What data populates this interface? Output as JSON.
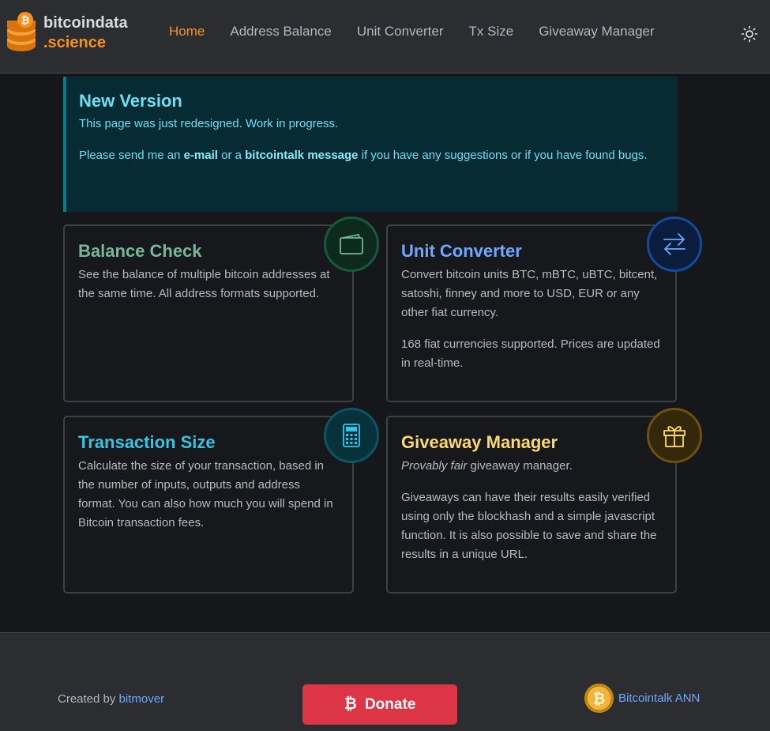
{
  "header": {
    "logo_line1": "bitcoindata",
    "logo_line2": ".science",
    "nav": [
      {
        "label": "Home",
        "active": true
      },
      {
        "label": "Address Balance",
        "active": false
      },
      {
        "label": "Unit Converter",
        "active": false
      },
      {
        "label": "Tx Size",
        "active": false
      },
      {
        "label": "Giveaway Manager",
        "active": false
      }
    ],
    "theme_icon": "sun-icon"
  },
  "alert": {
    "title": "New Version",
    "line1": "This page was just redesigned. Work in progress.",
    "line2_prefix": "Please send me an ",
    "email_link": "e-mail",
    "line2_mid": " or a ",
    "bct_link": "bitcointalk message",
    "line2_suffix": " if you have any suggestions or if you have found bugs."
  },
  "cards": {
    "balance": {
      "title": "Balance Check",
      "text": "See the balance of multiple bitcoin addresses at the same time. All address formats supported.",
      "icon": "wallet-icon",
      "color": "#75b798"
    },
    "unit": {
      "title": "Unit Converter",
      "text1": "Convert bitcoin units BTC, mBTC, uBTC, bitcent, satoshi, finney and more to USD, EUR or any other fiat currency.",
      "text2": "168 fiat currencies supported. Prices are updated in real-time.",
      "icon": "arrows-exchange-icon",
      "color": "#6ea8fe"
    },
    "tx": {
      "title": "Transaction Size",
      "text": "Calculate the size of your transaction, based in the number of inputs, outputs and address format. You can also how much you will spend in Bitcoin transaction fees.",
      "icon": "calculator-icon",
      "color": "#33c5e8"
    },
    "giveaway": {
      "title": "Giveaway Manager",
      "text1_em": "Provably fair",
      "text1_rest": " giveaway manager.",
      "text2": "Giveaways can have their results easily verified using only the blockhash and a simple javascript function. It is also possible to save and share the results in a unique URL.",
      "icon": "gift-icon",
      "color": "#ffda6a"
    }
  },
  "footer": {
    "created_prefix": "Created by ",
    "created_link": "bitmover",
    "donate_label": "Donate",
    "ann_label": "Bitcointalk ANN"
  }
}
